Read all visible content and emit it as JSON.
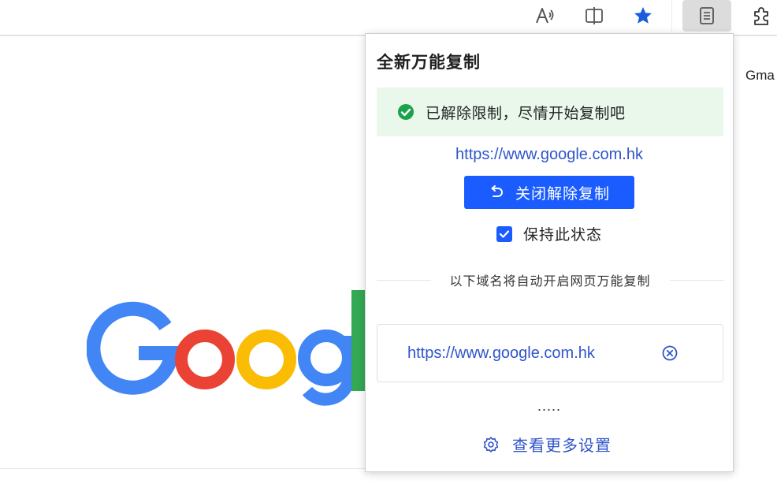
{
  "toolbar": {
    "icons": [
      "read-aloud-icon",
      "split-screen-icon",
      "favorite-star-icon",
      "extension-reader-icon",
      "extensions-puzzle-icon"
    ]
  },
  "page": {
    "gmail_link": "Gma"
  },
  "popup": {
    "title": "全新万能复制",
    "alert": {
      "text": "已解除限制，尽情开始复制吧",
      "color": "#1aa34a"
    },
    "current_url": "https://www.google.com.hk",
    "close_button_label": "关闭解除复制",
    "keep_state": {
      "label": "保持此状态",
      "checked": true
    },
    "separator_text": "以下域名将自动开启网页万能复制",
    "domains": [
      {
        "url": "https://www.google.com.hk"
      }
    ],
    "more": ".....",
    "settings_label": "查看更多设置",
    "accent_color": "#1a5cff",
    "link_color": "#2f55c9"
  }
}
